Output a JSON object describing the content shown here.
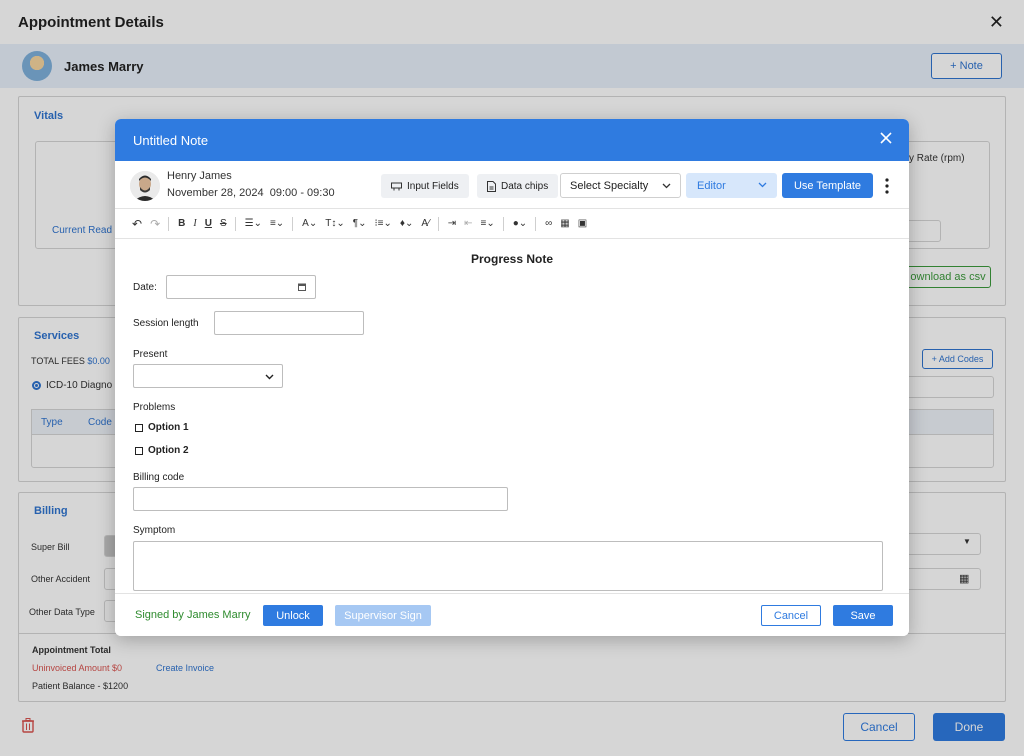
{
  "background": {
    "title": "Appointment Details",
    "patient_name": "James Marry",
    "note_button": "+ Note",
    "vitals": {
      "title": "Vitals",
      "column_header": "y Rate (rpm)",
      "current_reading": "Current Read",
      "download_csv": "ownload as csv"
    },
    "services": {
      "title": "Services",
      "total_fees_label": "TOTAL FEES",
      "total_fees_value": "$0.00",
      "add_codes": "+ Add Codes",
      "icd_label": "ICD-10 Diagno",
      "col_type": "Type",
      "col_code": "Code"
    },
    "billing": {
      "title": "Billing",
      "super_bill": "Super Bill",
      "other_accident": "Other Accident",
      "other_data_type": "Other Data Type"
    },
    "appointment_total": {
      "title": "Appointment Total",
      "uninvoiced": "Uninvoiced Amount $0",
      "create_invoice": "Create Invoice",
      "patient_balance": "Patient Balance - $1200"
    },
    "footer": {
      "cancel": "Cancel",
      "done": "Done"
    }
  },
  "modal": {
    "title": "Untitled Note",
    "provider": {
      "name": "Henry James",
      "date": "November 28, 2024",
      "time": "09:00 - 09:30"
    },
    "toolbar": {
      "input_fields": "Input Fields",
      "data_chips": "Data chips",
      "specialty_placeholder": "Select Specialty",
      "editor_mode": "Editor",
      "use_template": "Use Template"
    },
    "form": {
      "title": "Progress Note",
      "date_label": "Date:",
      "session_length_label": "Session length",
      "present_label": "Present",
      "problems_label": "Problems",
      "options": [
        "Option 1",
        "Option 2"
      ],
      "billing_code_label": "Billing code",
      "symptom_label": "Symptom"
    },
    "footer": {
      "signed_by": "Signed by James Marry",
      "unlock": "Unlock",
      "supervisor_sign": "Supervisor Sign",
      "cancel": "Cancel",
      "save": "Save"
    }
  },
  "colors": {
    "primary": "#2f7be0",
    "signed_green": "#2e8b2e",
    "error_red": "#d9534f"
  }
}
